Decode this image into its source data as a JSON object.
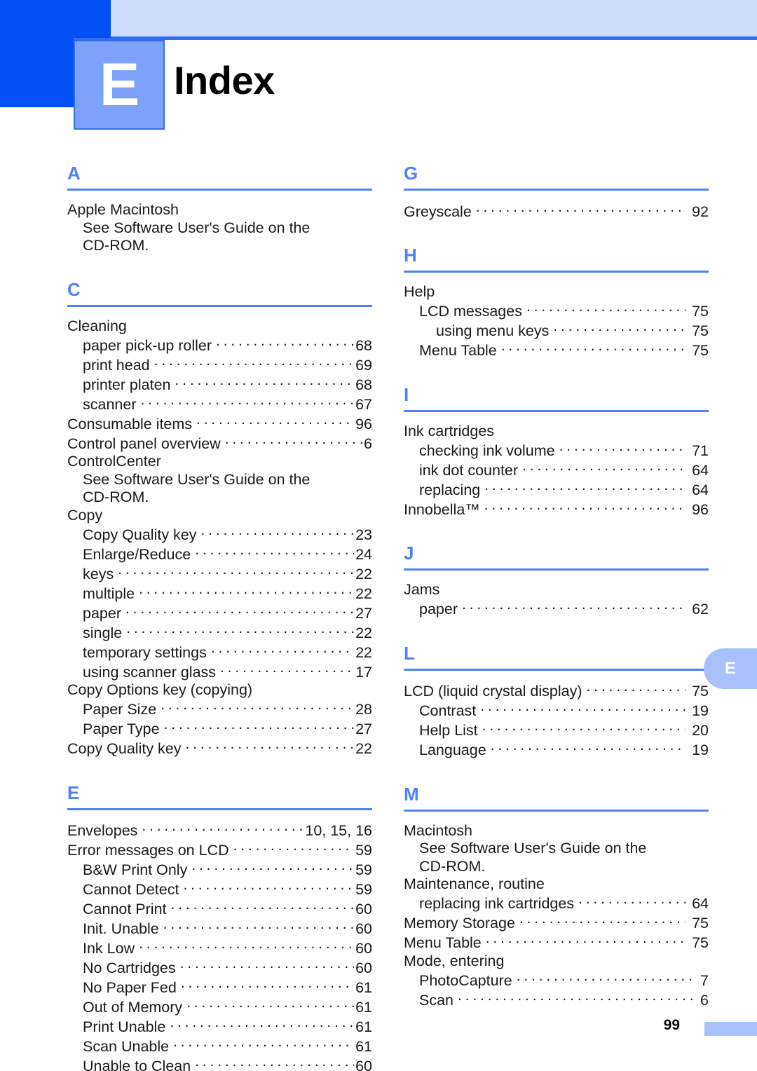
{
  "header": {
    "chapter_letter": "E",
    "title": "Index"
  },
  "thumb_tab": {
    "letter": "E"
  },
  "footer": {
    "page_number": "99"
  },
  "colors": {
    "accent_dark_blue": "#0050f5",
    "accent_light_blue": "#cddcf8",
    "chapter_box_blue": "#7da2fb",
    "section_letter_blue": "#4f82f7",
    "tab_blue": "#a8c0fb"
  },
  "left_column": [
    {
      "letter": "A",
      "entries": [
        {
          "type": "plain",
          "level": 0,
          "label": "Apple Macintosh"
        },
        {
          "type": "plain",
          "level": 1,
          "label": "See Software User's Guide on the"
        },
        {
          "type": "plain",
          "level": 1,
          "label": "CD-ROM."
        }
      ]
    },
    {
      "letter": "C",
      "entries": [
        {
          "type": "plain",
          "level": 0,
          "label": "Cleaning"
        },
        {
          "type": "dotted",
          "level": 1,
          "label": "paper pick-up roller",
          "page": "68"
        },
        {
          "type": "dotted",
          "level": 1,
          "label": "print head",
          "page": "69"
        },
        {
          "type": "dotted",
          "level": 1,
          "label": "printer platen",
          "page": "68"
        },
        {
          "type": "dotted",
          "level": 1,
          "label": "scanner",
          "page": "67"
        },
        {
          "type": "dotted",
          "level": 0,
          "label": "Consumable items",
          "page": "96"
        },
        {
          "type": "dotted",
          "level": 0,
          "label": "Control panel overview",
          "page": "6"
        },
        {
          "type": "plain",
          "level": 0,
          "label": "ControlCenter"
        },
        {
          "type": "plain",
          "level": 1,
          "label": "See Software User's Guide on the"
        },
        {
          "type": "plain",
          "level": 1,
          "label": "CD-ROM."
        },
        {
          "type": "plain",
          "level": 0,
          "label": "Copy"
        },
        {
          "type": "dotted",
          "level": 1,
          "label": "Copy Quality key",
          "page": "23"
        },
        {
          "type": "dotted",
          "level": 1,
          "label": "Enlarge/Reduce",
          "page": "24"
        },
        {
          "type": "dotted",
          "level": 1,
          "label": "keys",
          "page": "22"
        },
        {
          "type": "dotted",
          "level": 1,
          "label": "multiple",
          "page": "22"
        },
        {
          "type": "dotted",
          "level": 1,
          "label": "paper",
          "page": "27"
        },
        {
          "type": "dotted",
          "level": 1,
          "label": "single",
          "page": "22"
        },
        {
          "type": "dotted",
          "level": 1,
          "label": "temporary settings",
          "page": "22"
        },
        {
          "type": "dotted",
          "level": 1,
          "label": "using scanner glass",
          "page": "17"
        },
        {
          "type": "plain",
          "level": 0,
          "label": "Copy Options key (copying)"
        },
        {
          "type": "dotted",
          "level": 1,
          "label": "Paper Size",
          "page": "28"
        },
        {
          "type": "dotted",
          "level": 1,
          "label": "Paper Type",
          "page": "27"
        },
        {
          "type": "dotted",
          "level": 0,
          "label": "Copy Quality key",
          "page": "22"
        }
      ]
    },
    {
      "letter": "E",
      "entries": [
        {
          "type": "dotted",
          "level": 0,
          "label": "Envelopes",
          "page": "10, 15, 16"
        },
        {
          "type": "dotted",
          "level": 0,
          "label": "Error messages on LCD",
          "page": "59"
        },
        {
          "type": "dotted",
          "level": 1,
          "label": "B&W Print Only",
          "page": "59"
        },
        {
          "type": "dotted",
          "level": 1,
          "label": "Cannot Detect",
          "page": "59"
        },
        {
          "type": "dotted",
          "level": 1,
          "label": "Cannot Print",
          "page": "60"
        },
        {
          "type": "dotted",
          "level": 1,
          "label": "Init. Unable",
          "page": "60"
        },
        {
          "type": "dotted",
          "level": 1,
          "label": "Ink Low",
          "page": "60"
        },
        {
          "type": "dotted",
          "level": 1,
          "label": "No Cartridges",
          "page": "60"
        },
        {
          "type": "dotted",
          "level": 1,
          "label": "No Paper Fed",
          "page": "61"
        },
        {
          "type": "dotted",
          "level": 1,
          "label": "Out of Memory",
          "page": "61"
        },
        {
          "type": "dotted",
          "level": 1,
          "label": "Print Unable",
          "page": "61"
        },
        {
          "type": "dotted",
          "level": 1,
          "label": "Scan Unable",
          "page": "61"
        },
        {
          "type": "dotted",
          "level": 1,
          "label": "Unable to Clean",
          "page": "60"
        }
      ]
    }
  ],
  "right_column": [
    {
      "letter": "G",
      "entries": [
        {
          "type": "dotted",
          "level": 0,
          "label": "Greyscale",
          "page": "92"
        }
      ]
    },
    {
      "letter": "H",
      "entries": [
        {
          "type": "plain",
          "level": 0,
          "label": "Help"
        },
        {
          "type": "dotted",
          "level": 1,
          "label": "LCD messages",
          "page": "75"
        },
        {
          "type": "dotted",
          "level": 2,
          "label": "using menu keys",
          "page": "75"
        },
        {
          "type": "dotted",
          "level": 1,
          "label": "Menu Table",
          "page": "75"
        }
      ]
    },
    {
      "letter": "I",
      "entries": [
        {
          "type": "plain",
          "level": 0,
          "label": "Ink cartridges"
        },
        {
          "type": "dotted",
          "level": 1,
          "label": "checking ink volume",
          "page": "71"
        },
        {
          "type": "dotted",
          "level": 1,
          "label": "ink dot counter",
          "page": "64"
        },
        {
          "type": "dotted",
          "level": 1,
          "label": "replacing",
          "page": "64"
        },
        {
          "type": "dotted",
          "level": 0,
          "label": "Innobella™",
          "page": "96"
        }
      ]
    },
    {
      "letter": "J",
      "entries": [
        {
          "type": "plain",
          "level": 0,
          "label": "Jams"
        },
        {
          "type": "dotted",
          "level": 1,
          "label": "paper",
          "page": "62"
        }
      ]
    },
    {
      "letter": "L",
      "entries": [
        {
          "type": "dotted",
          "level": 0,
          "label": "LCD (liquid crystal display)",
          "page": "75"
        },
        {
          "type": "dotted",
          "level": 1,
          "label": "Contrast",
          "page": "19"
        },
        {
          "type": "dotted",
          "level": 1,
          "label": "Help List",
          "page": "20"
        },
        {
          "type": "dotted",
          "level": 1,
          "label": "Language",
          "page": "19"
        }
      ]
    },
    {
      "letter": "M",
      "entries": [
        {
          "type": "plain",
          "level": 0,
          "label": "Macintosh"
        },
        {
          "type": "plain",
          "level": 1,
          "label": "See Software User's Guide on the"
        },
        {
          "type": "plain",
          "level": 1,
          "label": "CD-ROM."
        },
        {
          "type": "plain",
          "level": 0,
          "label": "Maintenance, routine"
        },
        {
          "type": "dotted",
          "level": 1,
          "label": "replacing ink cartridges",
          "page": "64"
        },
        {
          "type": "dotted",
          "level": 0,
          "label": "Memory Storage",
          "page": "75"
        },
        {
          "type": "dotted",
          "level": 0,
          "label": "Menu Table",
          "page": "75"
        },
        {
          "type": "plain",
          "level": 0,
          "label": "Mode, entering"
        },
        {
          "type": "dotted",
          "level": 1,
          "label": "PhotoCapture",
          "page": "7"
        },
        {
          "type": "dotted",
          "level": 1,
          "label": "Scan",
          "page": "6"
        }
      ]
    }
  ]
}
